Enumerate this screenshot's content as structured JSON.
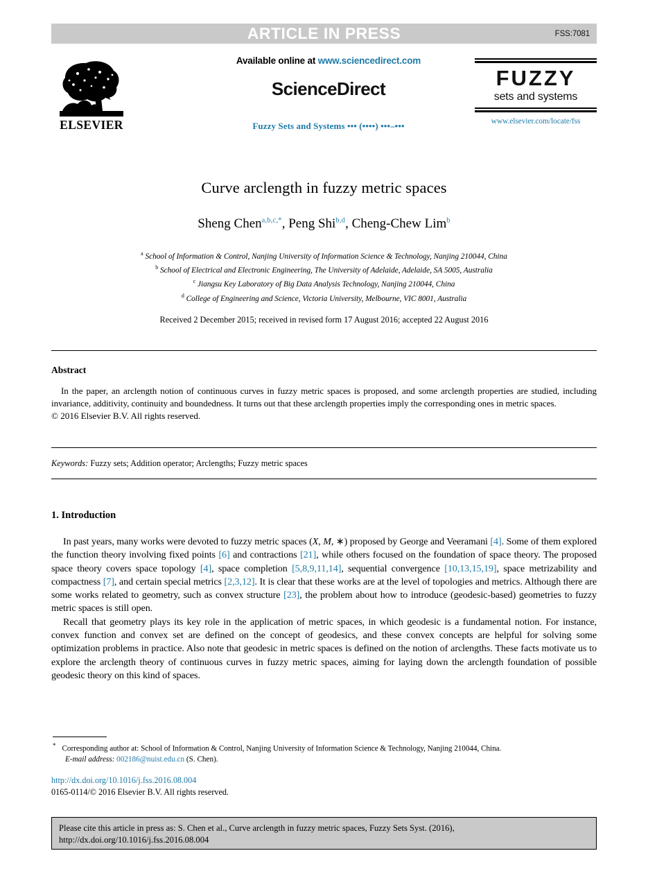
{
  "banner": {
    "press_text": "ARTICLE IN PRESS",
    "article_code": "FSS:7081",
    "bar_color": "#c9c9c9"
  },
  "masthead": {
    "available_prefix": "Available online at ",
    "sciencedirect_url": "www.sciencedirect.com",
    "sciencedirect_wordmark": "ScienceDirect",
    "journal_reference": "Fuzzy Sets and Systems ••• (••••) •••–•••",
    "publisher_logo_text": "ELSEVIER",
    "journal_logo_title": "FUZZY",
    "journal_logo_subtitle": "sets and systems",
    "journal_url": "www.elsevier.com/locate/fss",
    "link_color": "#1f7ba8"
  },
  "article": {
    "title": "Curve arclength in fuzzy metric spaces",
    "authors": [
      {
        "name": "Sheng Chen",
        "marks": "a,b,c,",
        "star": "*",
        "trailing": ", "
      },
      {
        "name": "Peng Shi",
        "marks": "b,d",
        "star": "",
        "trailing": ", "
      },
      {
        "name": "Cheng-Chew Lim",
        "marks": "b",
        "star": "",
        "trailing": ""
      }
    ],
    "affiliations": [
      {
        "label": "a",
        "text": "School of Information & Control, Nanjing University of Information Science & Technology, Nanjing 210044, China"
      },
      {
        "label": "b",
        "text": "School of Electrical and Electronic Engineering, The University of Adelaide, Adelaide, SA 5005, Australia"
      },
      {
        "label": "c",
        "text": "Jiangsu Key Laboratory of Big Data Analysis Technology, Nanjing 210044, China"
      },
      {
        "label": "d",
        "text": "College of Engineering and Science, Victoria University, Melbourne, VIC 8001, Australia"
      }
    ],
    "history": "Received 2 December 2015; received in revised form 17 August 2016; accepted 22 August 2016"
  },
  "abstract": {
    "heading": "Abstract",
    "text": "In the paper, an arclength notion of continuous curves in fuzzy metric spaces is proposed, and some arclength properties are studied, including invariance, additivity, continuity and boundedness. It turns out that these arclength properties imply the corresponding ones in metric spaces.",
    "copyright": "© 2016 Elsevier B.V. All rights reserved."
  },
  "keywords": {
    "label": "Keywords:",
    "list": " Fuzzy sets; Addition operator; Arclengths; Fuzzy metric spaces"
  },
  "introduction": {
    "heading": "1.  Introduction",
    "paragraph1_parts": {
      "p1a": "In past years, many works were devoted to fuzzy metric spaces (",
      "var_x": "X",
      "p1b": ", ",
      "var_m": "M",
      "p1c": ", ",
      "var_star": "∗",
      "p1d": ") proposed by George and Veeramani ",
      "r4a": "[4]",
      "p1e": ". Some of them explored the function theory involving fixed points ",
      "r6": "[6]",
      "p1f": " and contractions ",
      "r21": "[21]",
      "p1g": ", while others focused on the foundation of space theory. The proposed space theory covers space topology ",
      "r4b": "[4]",
      "p1h": ", space completion ",
      "r58911": "[5,8,9,11,14]",
      "p1i": ", sequential convergence ",
      "r10131519": "[10,13,15,19]",
      "p1j": ", space metrizability and compactness ",
      "r7": "[7]",
      "p1k": ", and certain special metrics ",
      "r2312": "[2,3,12]",
      "p1l": ". It is clear that these works are at the level of topologies and metrics. Although there are some works related to geometry, such as convex structure ",
      "r23": "[23]",
      "p1m": ", the problem about how to introduce (geodesic-based) geometries to fuzzy metric spaces is still open."
    },
    "paragraph2": "Recall that geometry plays its key role in the application of metric spaces, in which geodesic is a fundamental notion. For instance, convex function and convex set are defined on the concept of geodesics, and these convex concepts are helpful for solving some optimization problems in practice. Also note that geodesic in metric spaces is defined on the notion of arclengths. These facts motivate us to explore the arclength theory of continuous curves in fuzzy metric spaces, aiming for laying down the arclength foundation of possible geodesic theory on this kind of spaces."
  },
  "footnote": {
    "star": "*",
    "corresponding": "Corresponding author at: School of Information & Control, Nanjing University of Information Science & Technology, Nanjing 210044, China.",
    "email_label": "E-mail address:",
    "email": "002186@nuist.edu.cn",
    "email_suffix": " (S. Chen)."
  },
  "publication": {
    "doi_url": "http://dx.doi.org/10.1016/j.fss.2016.08.004",
    "issn_line": "0165-0114/© 2016 Elsevier B.V. All rights reserved."
  },
  "cite_box": {
    "line1": "Please cite this article in press as: S. Chen et al., Curve arclength in fuzzy metric spaces, Fuzzy Sets Syst. (2016),",
    "line2": "http://dx.doi.org/10.1016/j.fss.2016.08.004"
  }
}
